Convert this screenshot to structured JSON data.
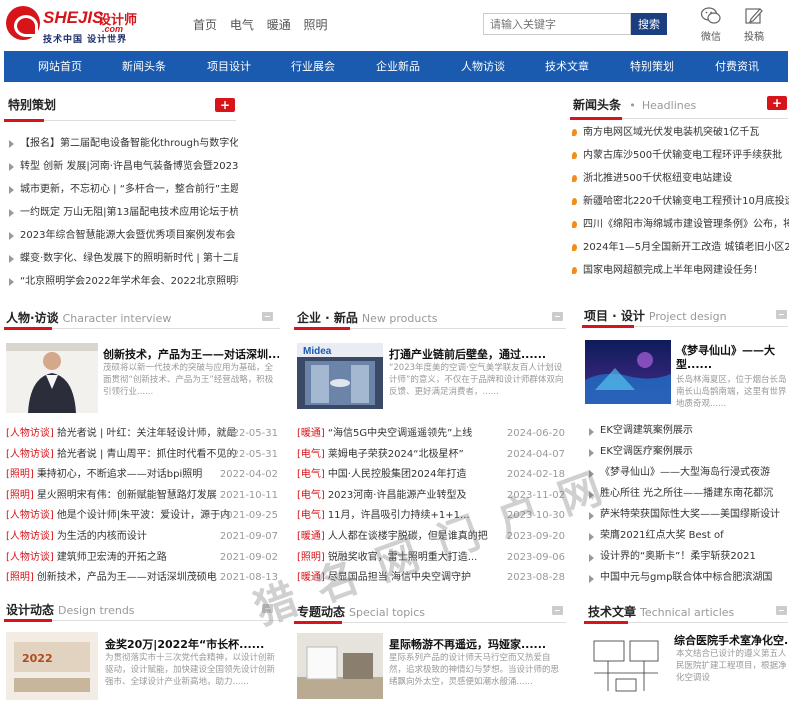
{
  "logo": {
    "word": "SHEJIS",
    "cn": "设计师",
    "com": ".com",
    "slogan": "技术中国  设计世界"
  },
  "topnav": [
    "首页",
    "电气",
    "暖通",
    "照明"
  ],
  "search": {
    "placeholder": "请输入关键字",
    "button": "搜索"
  },
  "header_icons": {
    "wechat": "微信",
    "submit": "投稿"
  },
  "mainnav": [
    "网站首页",
    "新闻头条",
    "项目设计",
    "行业展会",
    "企业新品",
    "人物访谈",
    "技术文章",
    "特别策划",
    "付费资讯"
  ],
  "special": {
    "title": "特别策划",
    "items": [
      "【报名】第二届配电设备智能化through与数字化应用论",
      "转型 创新 发展|河南·许昌电气装备博览会暨2023年",
      "城市更新，不忘初心 | “多杆合一，整合前行”主题",
      "一约既定 万山无阻|第13届配电技术应用论坛于杭州",
      "2023年综合智慧能源大会暨优秀项目案例发布会",
      "蝶变·数字化、绿色发展下的照明新时代 | 第十二届",
      "“北京照明学会2022年学术年会、2022北京照明科"
    ]
  },
  "news": {
    "title": "新闻头条",
    "en": "Headlines",
    "items": [
      "南方电网区域光伏发电装机突破1亿千瓦",
      "内蒙古库沙500千伏输变电工程环评手续获批",
      "浙北推进500千伏枢纽变电站建设",
      "新疆哈密北220千伏输变电工程预计10月底投运",
      "四川《绵阳市海绵城市建设管理条例》公布，将于",
      "2024年1—5月全国新开工改造 城镇老旧小区2.26",
      "国家电网超额完成上半年电网建设任务！"
    ]
  },
  "interview": {
    "title": "人物·访谈",
    "en": "Character interview",
    "feature": {
      "title": "创新技术，产品为王——对话深圳......",
      "desc": "茂硕将以新一代技术的突破与应用为基础，全面贯彻“创新技术、产品为王”经营战略，积极引领行业......"
    },
    "items": [
      {
        "tag": "[人物访谈]",
        "text": "拾光者说 | 叶红：关注年轻设计师，就是",
        "date": "2022-05-31"
      },
      {
        "tag": "[人物访谈]",
        "text": "拾光者说 | 青山周平：抓住时代看不见的",
        "date": "2022-05-31"
      },
      {
        "tag": "[照明]",
        "text": "秉持初心，不断追求——对话bpi照明",
        "date": "2022-04-02"
      },
      {
        "tag": "[照明]",
        "text": "星火照明宋有伟：创新赋能智慧路灯发展",
        "date": "2021-10-11"
      },
      {
        "tag": "[人物访谈]",
        "text": "他是个设计师|朱平波：爱设计，源于内",
        "date": "2021-09-25"
      },
      {
        "tag": "[人物访谈]",
        "text": "为生活的内核而设计",
        "date": "2021-09-07"
      },
      {
        "tag": "[人物访谈]",
        "text": "建筑师卫宏涛的开拓之路",
        "date": "2021-09-02"
      },
      {
        "tag": "[照明]",
        "text": "创新技术，产品为王——对话深圳茂硕电",
        "date": "2021-08-13"
      }
    ]
  },
  "products": {
    "title": "企业 · 新品",
    "en": "New products",
    "feature": {
      "title": "打通产业链前后壁垒，通过......",
      "desc": "“2023年度美的空调·空气美学联友百人计划设计师”的意义，不仅在于品牌和设计师群体双向反馈、更好满足消费者，......"
    },
    "items": [
      {
        "tag": "[暖通]",
        "text": "“海信5G中央空调遥遥领先”上线",
        "date": "2024-06-20"
      },
      {
        "tag": "[电气]",
        "text": "莱姆电子荣获2024“北极星杯”",
        "date": "2024-04-07"
      },
      {
        "tag": "[电气]",
        "text": "中国·人民控股集团2024年打造",
        "date": "2024-02-18"
      },
      {
        "tag": "[电气]",
        "text": "2023河南·许昌能源产业转型及",
        "date": "2023-11-02"
      },
      {
        "tag": "[电气]",
        "text": "11月，许昌吸引力持续+1+1...",
        "date": "2023-10-30"
      },
      {
        "tag": "[暖通]",
        "text": "人人都在谈楼宇脱碳，但是谁真的把",
        "date": "2023-09-20"
      },
      {
        "tag": "[照明]",
        "text": "锐融奖收官，雷士照明重大打造...",
        "date": "2023-09-06"
      },
      {
        "tag": "[暖通]",
        "text": "尽显国品担当 海信中央空调守护",
        "date": "2023-08-28"
      }
    ]
  },
  "projects": {
    "title": "项目 · 设计",
    "en": "Project design",
    "feature": {
      "title": "《梦寻仙山》——大型......",
      "desc": "长岛林海夏区，位于烟台长岛南长山岛鹊南端，这里有世界地质奇观......"
    },
    "items": [
      "EK空调建筑案例展示",
      "EK空调医疗案例展示",
      "《梦寻仙山》——大型海岛行浸式夜游",
      "胜心所往 光之所往——播建东南花都沉",
      "萨米特荣获国际性大奖——美国缪斯设计",
      "荣膺2021红点大奖 Best of",
      "设计界的“奥斯卡”！柔宇斩获2021",
      "中国中元与gmp联合体中标合肥滨湖国"
    ]
  },
  "design": {
    "title": "设计动态",
    "en": "Design trends",
    "feature": {
      "title": "金奖20万|2022年“市长杯......",
      "desc": "为贯彻落实市十三次党代会精神，以设计创新驱动，设计赋能，加快建设全国领先设计创新强市、全球设计产业新高地，助力......"
    }
  },
  "topics": {
    "title": "专题动态",
    "en": "Special topics",
    "feature": {
      "title": "星际畅游不再遥远，玛娅家......",
      "desc": "星际系列产品的设计师天马行空而又热爱自然，追求极致的神情幻与梦想。当设计师的思绪飘向外太空，灵感便如潮水般涌......"
    }
  },
  "articles": {
    "title": "技术文章",
    "en": "Technical articles",
    "feature": {
      "title": "综合医院手术室净化空......",
      "desc": "本文结合已设计的遵义第五人民医院扩建工程项目，根据净化空调设"
    }
  },
  "watermark": "猎 名 网 门 户 网",
  "colors": {
    "brand_red": "#d7141a",
    "nav_blue": "#1a5aaf",
    "search_blue": "#1b3e80",
    "tag_red": "#d7141a"
  }
}
